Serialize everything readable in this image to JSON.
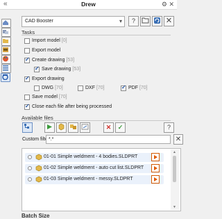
{
  "window": {
    "title": "Drew",
    "collapse_glyph": "«",
    "gear_glyph": "⚙",
    "pin_glyph": "📌"
  },
  "combo": {
    "selected": "CAD Booster"
  },
  "tasks": {
    "title": "Tasks",
    "import_model": {
      "label": "Import model",
      "count": "[0]",
      "checked": false
    },
    "export_model": {
      "label": "Export model",
      "checked": false
    },
    "create_drawing": {
      "label": "Create drawing",
      "count": "[53]",
      "checked": true
    },
    "save_drawing": {
      "label": "Save drawing",
      "count": "[53]",
      "checked": true
    },
    "export_drawing": {
      "label": "Export drawing",
      "checked": true
    },
    "dwg": {
      "label": "DWG",
      "count": "[70]",
      "checked": false
    },
    "dxf": {
      "label": "DXF",
      "count": "[70]",
      "checked": false
    },
    "pdf": {
      "label": "PDF",
      "count": "[70]",
      "checked": true
    },
    "save_model": {
      "label": "Save model",
      "count": "[70]",
      "checked": false
    },
    "close_each": {
      "label": "Close each file after being processed",
      "checked": true
    }
  },
  "files": {
    "title": "Available files",
    "filter_label": "Custom filter",
    "filter_value": "*.*",
    "rows": [
      "01-01 Simple weldment - 4 bodies.SLDPRT",
      "01-02 Simple weldment - auto cut list.SLDPRT",
      "01-03 Simple weldment - messy.SLDPRT"
    ]
  },
  "batch": {
    "title": "Batch Size"
  },
  "icons": [
    "home-icon",
    "assembly-icon",
    "folder-icon",
    "image-icon",
    "palette-icon",
    "list-icon",
    "drew-icon",
    "help-icon",
    "open-folder-icon",
    "refresh-icon",
    "close-icon",
    "solidworks-file-icon",
    "play-icon",
    "delete-icon",
    "check-icon"
  ],
  "colors": {
    "accent": "#1a4d9e",
    "play": "#e05a00",
    "row_bg": "#eaf1fb"
  }
}
